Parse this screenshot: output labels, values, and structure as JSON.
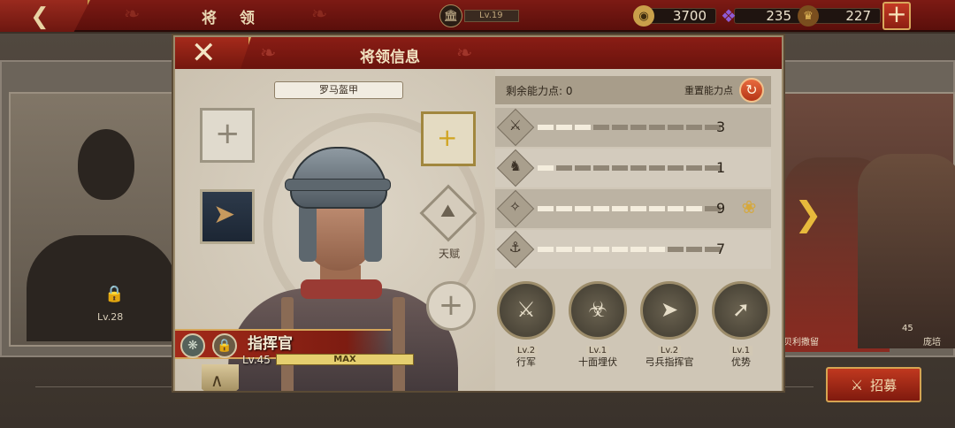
{
  "topbar": {
    "title": "将 领",
    "player_level": "Lv.19",
    "resources": [
      {
        "icon": "coin-icon",
        "value": "3700",
        "color": "#c9a04a"
      },
      {
        "icon": "crystal-icon",
        "value": "235",
        "color": "#8e5bd6"
      },
      {
        "icon": "laurel-helmet-icon",
        "value": "227",
        "color": "#c89b3c"
      }
    ]
  },
  "background": {
    "left_card_level": "Lv.28",
    "right_card_names": [
      "贝利撒留",
      "庞培"
    ],
    "right_card_level": "45",
    "recruit_label": "招募"
  },
  "modal": {
    "title": "将领信息",
    "armor_label": "罗马盔甲",
    "talent_label": "天赋",
    "general": {
      "name": "指挥官",
      "level": "Lv.45",
      "progress_label": "MAX"
    },
    "stats": {
      "remaining_label": "剩余能力点: 0",
      "reset_label": "重置能力点",
      "rows": [
        {
          "icon": "sword-icon",
          "value": "3",
          "filled": 3
        },
        {
          "icon": "horse-icon",
          "value": "1",
          "filled": 1
        },
        {
          "icon": "bow-icon",
          "value": "9",
          "filled": 9
        },
        {
          "icon": "anchor-icon",
          "value": "7",
          "filled": 7
        }
      ],
      "max_segments": 10
    },
    "skills": [
      {
        "level": "Lv.2",
        "name": "行军"
      },
      {
        "level": "Lv.1",
        "name": "十面埋伏"
      },
      {
        "level": "Lv.2",
        "name": "弓兵指挥官"
      },
      {
        "level": "Lv.1",
        "name": "优势"
      }
    ]
  }
}
